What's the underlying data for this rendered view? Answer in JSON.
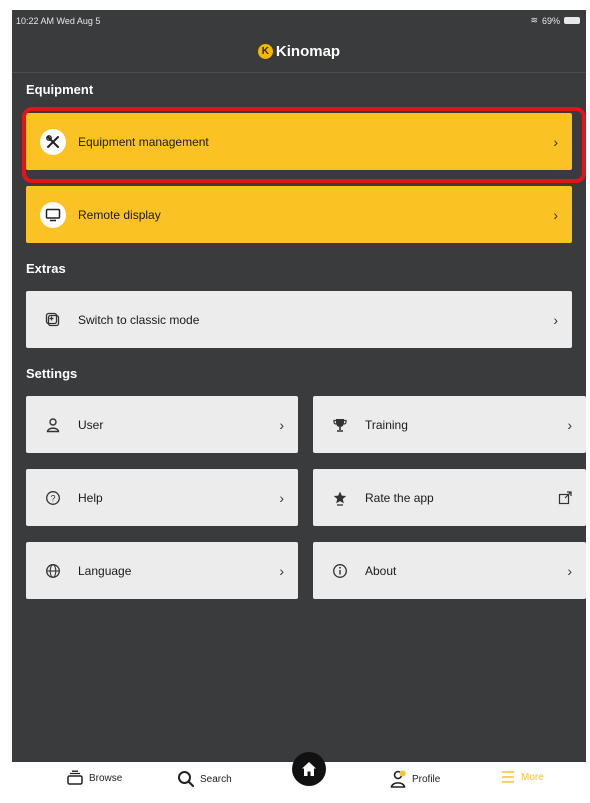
{
  "status_bar": {
    "time": "10:22 AM  Wed Aug 5",
    "battery": "69%"
  },
  "header": {
    "title": "Kinomap"
  },
  "sections": {
    "equipment": "Equipment",
    "extras": "Extras",
    "settings": "Settings"
  },
  "items": {
    "equipment_management": "Equipment management",
    "remote_display": "Remote display",
    "classic_mode": "Switch to classic mode",
    "user": "User",
    "training": "Training",
    "help": "Help",
    "rate_app": "Rate the app",
    "language": "Language",
    "about": "About"
  },
  "tabs": {
    "browse": "Browse",
    "search": "Search",
    "profile": "Profile",
    "more": "More"
  },
  "colors": {
    "accent_yellow": "#fbc223",
    "background_dark": "#3a3b3d",
    "highlight_red": "#e4131b"
  }
}
